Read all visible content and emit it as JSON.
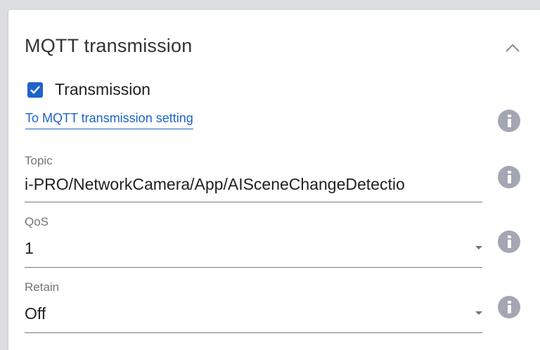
{
  "panel": {
    "title": "MQTT transmission"
  },
  "transmission": {
    "label": "Transmission",
    "checked": true
  },
  "link": {
    "label": "To MQTT transmission setting"
  },
  "topic": {
    "label": "Topic",
    "value": "i-PRO/NetworkCamera/App/AISceneChangeDetectio"
  },
  "qos": {
    "label": "QoS",
    "value": "1"
  },
  "retain": {
    "label": "Retain",
    "value": "Off"
  },
  "colors": {
    "accent": "#1e63c8",
    "info_icon": "#a3a6b3",
    "background": "#dcdde0"
  },
  "icons": {
    "collapse": "chevron-up-icon",
    "checkbox": "check-icon",
    "info": "info-icon",
    "dropdown": "caret-down-icon"
  }
}
